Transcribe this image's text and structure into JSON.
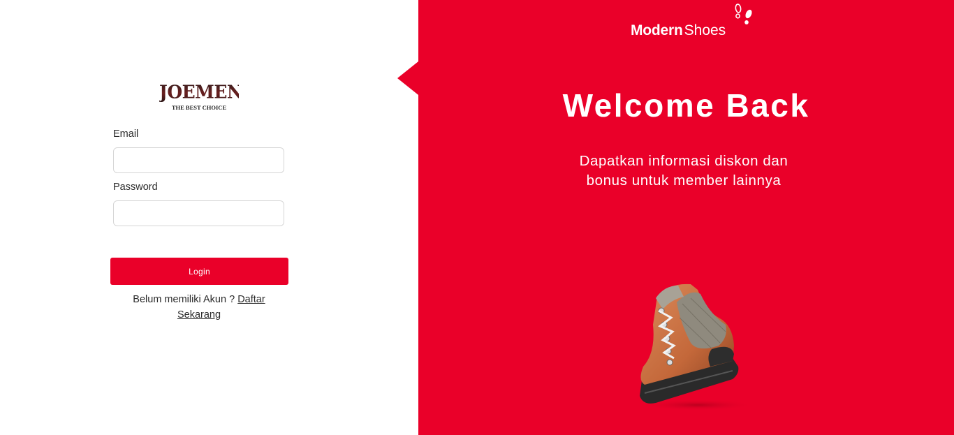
{
  "login": {
    "logo": {
      "name": "JOEMEN",
      "tagline": "THE BEST CHOICE"
    },
    "email_label": "Email",
    "email_value": "",
    "password_label": "Password",
    "password_value": "",
    "login_button": "Login",
    "register_prompt": "Belum memiliki Akun ?",
    "register_link": "Daftar Sekarang"
  },
  "promo": {
    "brand_part1": "Modern",
    "brand_part2": "Shoes",
    "heading": "Welcome Back",
    "subtitle_line1": "Dapatkan informasi diskon dan",
    "subtitle_line2": "bonus untuk member lainnya",
    "image": "hiking-boot-image"
  },
  "colors": {
    "accent": "#ea0029",
    "text": "#2b2b2b",
    "white": "#ffffff"
  }
}
